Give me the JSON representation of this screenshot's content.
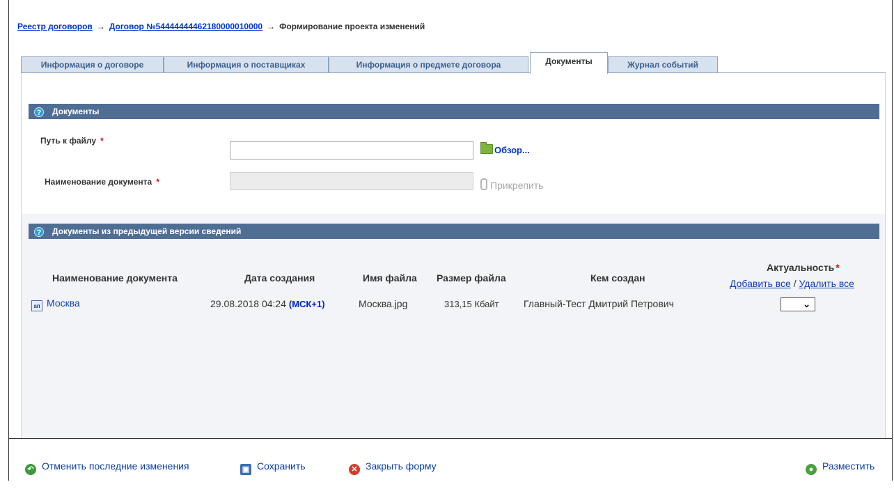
{
  "breadcrumb": {
    "item1": "Реестр договоров",
    "arrow": "→",
    "item2": "Договор №54444444462180000010000",
    "item3": "Формирование проекта изменений"
  },
  "tabs": [
    {
      "label": "Информация о договоре",
      "active": false
    },
    {
      "label": "Информация о поставщиках",
      "active": false
    },
    {
      "label": "Информация о предмете договора",
      "active": false
    },
    {
      "label": "Документы",
      "active": true
    },
    {
      "label": "Журнал событий",
      "active": false
    }
  ],
  "documents_section": {
    "title": "Документы",
    "help_icon": "question-icon",
    "file_path_label": "Путь к файлу",
    "required_mark": "*",
    "browse_label": "Обзор...",
    "doc_name_label": "Наименование документа",
    "attach_label": "Прикрепить",
    "file_path_value": "",
    "doc_name_value": ""
  },
  "prev_section": {
    "title": "Документы из предыдущей версии сведений",
    "columns": {
      "name": "Наименование документа",
      "created": "Дата создания",
      "filename": "Имя файла",
      "size": "Размер файла",
      "author": "Кем создан",
      "actual": "Актуальность"
    },
    "add_all": "Добавить все",
    "separator": "/",
    "remove_all": "Удалить все",
    "rows": [
      {
        "icon_text": "ап",
        "name": "Москва",
        "created": "29.08.2018 04:24",
        "timezone": "(МСК+1)",
        "filename": "Москва.jpg",
        "size": "313,15 Кбайт",
        "author": "Главный-Тест Дмитрий Петрович",
        "actual": ""
      }
    ]
  },
  "footer": {
    "undo": "Отменить последние изменения",
    "save": "Сохранить",
    "close": "Закрыть форму",
    "publish": "Разместить"
  },
  "colors": {
    "section_header": "#506e94",
    "link": "#0b3ea8",
    "required": "#dd0000"
  }
}
